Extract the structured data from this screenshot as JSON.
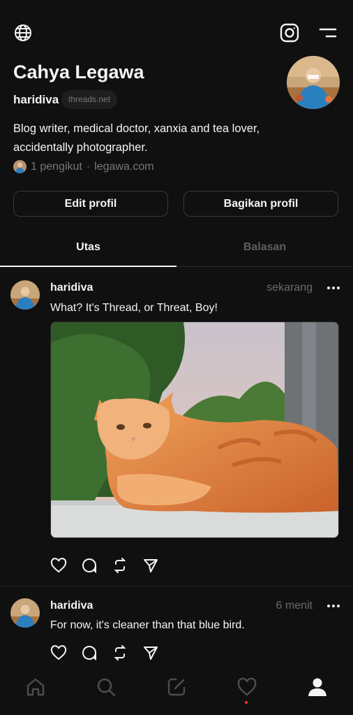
{
  "profile": {
    "name": "Cahya Legawa",
    "username": "haridiva",
    "domain_badge": "threads.net",
    "bio_line1": "Blog writer, medical doctor, xanxia and tea lover,",
    "bio_line2": "accidentally photographer.",
    "followers": "1 pengikut",
    "separator": "·",
    "website": "legawa.com"
  },
  "buttons": {
    "edit_profile": "Edit profil",
    "share_profile": "Bagikan profil"
  },
  "tabs": [
    {
      "label": "Utas",
      "active": true
    },
    {
      "label": "Balasan",
      "active": false
    }
  ],
  "posts": [
    {
      "username": "haridiva",
      "time": "sekarang",
      "text": "What? It's Thread, or Threat, Boy!",
      "has_image": true
    },
    {
      "username": "haridiva",
      "time": "6 menit",
      "text": "For now, it's cleaner than that blue bird.",
      "has_image": false
    }
  ],
  "icons": {
    "globe": "globe-icon",
    "instagram": "instagram-icon",
    "menu": "menu-icon",
    "like": "heart-icon",
    "comment": "comment-icon",
    "repost": "repost-icon",
    "share": "send-icon",
    "nav": [
      "home-icon",
      "search-icon",
      "compose-icon",
      "activity-icon",
      "profile-icon"
    ]
  },
  "colors": {
    "background": "#101010",
    "text_primary": "#f3f5f7",
    "text_secondary": "#777777",
    "notification_dot": "#ff3040"
  }
}
